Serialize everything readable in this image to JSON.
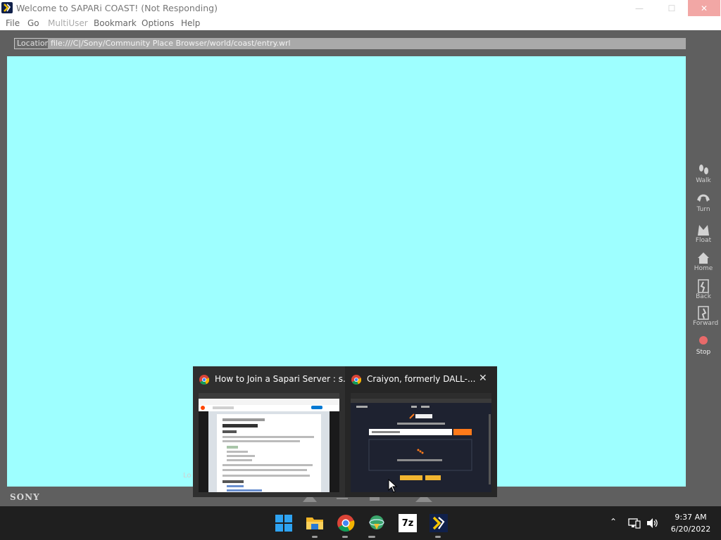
{
  "window": {
    "title": "Welcome to SAPARi COAST! (Not Responding)",
    "min_icon": "minimize-icon",
    "max_icon": "maximize-icon",
    "close_icon": "close-icon"
  },
  "menu": {
    "file": "File",
    "go": "Go",
    "multiuser": "MultiUser",
    "bookmark": "Bookmark",
    "options": "Options",
    "help": "Help"
  },
  "location": {
    "label": "Location:",
    "value": "file:///C|/Sony/Community Place Browser/world/coast/entry.wrl"
  },
  "viewport": {
    "background": "#9effff",
    "partial_text": "Lo"
  },
  "brand": "SONY",
  "nav": {
    "walk": "Walk",
    "turn": "Turn",
    "float": "Float",
    "home": "Home",
    "back": "Back",
    "forward": "Forward",
    "stop": "Stop",
    "stop_color": "#e86a6a"
  },
  "thumbnails": {
    "first": {
      "title": "How to Join a Sapari Server : s..."
    },
    "second": {
      "title": "Craiyon, formerly DALL-...",
      "close_icon": "close-icon"
    }
  },
  "taskbar": {
    "icons": [
      "windows-start-icon",
      "file-explorer-icon",
      "chrome-icon",
      "internet-download-icon",
      "7zip-icon",
      "community-place-browser-icon"
    ],
    "sevenzip_text": "7z"
  },
  "clock": {
    "time": "9:37 AM",
    "date": "6/20/2022"
  }
}
